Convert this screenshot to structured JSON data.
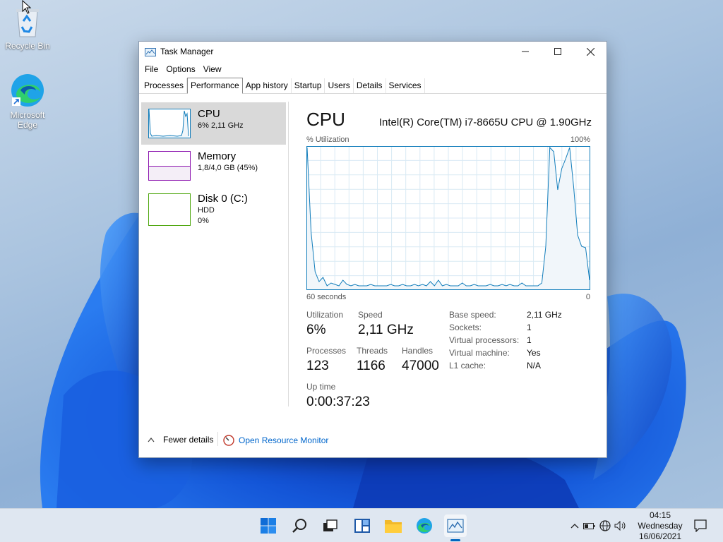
{
  "desktop": {
    "icons": [
      {
        "label": "Recycle Bin"
      },
      {
        "label_line1": "Microsoft",
        "label_line2": "Edge"
      }
    ]
  },
  "window": {
    "title": "Task Manager",
    "menu": [
      "File",
      "Options",
      "View"
    ],
    "tabs": [
      "Processes",
      "Performance",
      "App history",
      "Startup",
      "Users",
      "Details",
      "Services"
    ],
    "active_tab": "Performance"
  },
  "sidebar": {
    "items": [
      {
        "name": "CPU",
        "sub1": "6% 2,11 GHz",
        "sub2": "",
        "color": "#117dbb",
        "selected": true
      },
      {
        "name": "Memory",
        "sub1": "1,8/4,0 GB (45%)",
        "sub2": "",
        "color": "#8b12ae",
        "selected": false
      },
      {
        "name": "Disk 0 (C:)",
        "sub1": "HDD",
        "sub2": "0%",
        "color": "#4da60c",
        "selected": false
      }
    ]
  },
  "cpu": {
    "title": "CPU",
    "model": "Intel(R) Core(TM) i7-8665U CPU @ 1.90GHz",
    "graph_label_left": "% Utilization",
    "graph_label_right": "100%",
    "graph_bottom_left": "60 seconds",
    "graph_bottom_right": "0",
    "utilization_series": [
      100,
      40,
      12,
      5,
      8,
      2,
      4,
      3,
      2,
      6,
      3,
      2,
      3,
      2,
      2,
      2,
      3,
      2,
      2,
      2,
      2,
      3,
      2,
      2,
      3,
      2,
      2,
      3,
      2,
      3,
      2,
      5,
      2,
      6,
      2,
      3,
      2,
      2,
      2,
      4,
      2,
      2,
      3,
      2,
      2,
      2,
      3,
      2,
      2,
      3,
      2,
      3,
      2,
      2,
      4,
      2,
      2,
      2,
      2,
      4,
      30,
      100,
      97,
      70,
      85,
      92,
      100,
      72,
      38,
      30,
      29,
      6
    ],
    "stats": {
      "utilization_label": "Utilization",
      "utilization_value": "6%",
      "speed_label": "Speed",
      "speed_value": "2,11 GHz",
      "processes_label": "Processes",
      "processes_value": "123",
      "threads_label": "Threads",
      "threads_value": "1166",
      "handles_label": "Handles",
      "handles_value": "47000",
      "uptime_label": "Up time",
      "uptime_value": "0:00:37:23"
    },
    "info": [
      {
        "k": "Base speed:",
        "v": "2,11 GHz"
      },
      {
        "k": "Sockets:",
        "v": "1"
      },
      {
        "k": "Virtual processors:",
        "v": "1"
      },
      {
        "k": "Virtual machine:",
        "v": "Yes"
      },
      {
        "k": "L1 cache:",
        "v": "N/A"
      }
    ]
  },
  "footer": {
    "fewer_details": "Fewer details",
    "open_resource_monitor": "Open Resource Monitor"
  },
  "taskbar": {
    "time": "04:15",
    "day": "Wednesday",
    "date": "16/06/2021"
  },
  "colors": {
    "cpu_line": "#117dbb",
    "cpu_fill": "#f1f6fa",
    "grid": "#d9eaf4",
    "link": "#0066cc"
  }
}
